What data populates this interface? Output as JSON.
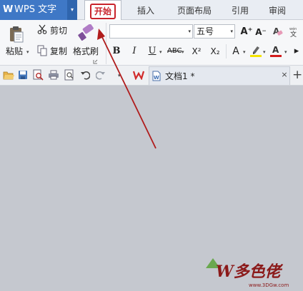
{
  "app": {
    "title": "WPS 文字",
    "logo_letter": "W",
    "menu_arrow": "▾"
  },
  "tabs": [
    {
      "label": "开始",
      "active": true,
      "highlighted": true
    },
    {
      "label": "插入"
    },
    {
      "label": "页面布局"
    },
    {
      "label": "引用"
    },
    {
      "label": "审阅"
    }
  ],
  "ribbon": {
    "clipboard": {
      "paste_label": "粘贴",
      "cut_label": "剪切",
      "copy_label": "复制",
      "format_painter_label": "格式刷"
    },
    "font": {
      "font_name": "",
      "font_size": "五号",
      "grow_label": "A⁺",
      "shrink_label": "A⁻",
      "bold_label": "B",
      "italic_label": "I",
      "underline_label": "U",
      "strike_label": "ABC",
      "superscript_label": "X²",
      "subscript_label": "X₂",
      "text_effect_label": "A",
      "more_label": "▸",
      "caret": "▾"
    }
  },
  "quick_access": {
    "icons": [
      "open-folder-icon",
      "save-icon",
      "print-preview-icon",
      "print-icon",
      "preview-icon",
      "undo-icon",
      "redo-icon"
    ],
    "caret": "▾"
  },
  "document_tab": {
    "title": "文档1 *",
    "close_label": "×",
    "new_tab_label": "+"
  },
  "watermark": {
    "text": "W多色佬",
    "url": "www.3DGw.com"
  },
  "colors": {
    "accent_blue": "#3f78c6",
    "highlight_red": "#c8232b",
    "arrow_red": "#b01c1c",
    "workspace_gray": "#c5c8cf"
  }
}
